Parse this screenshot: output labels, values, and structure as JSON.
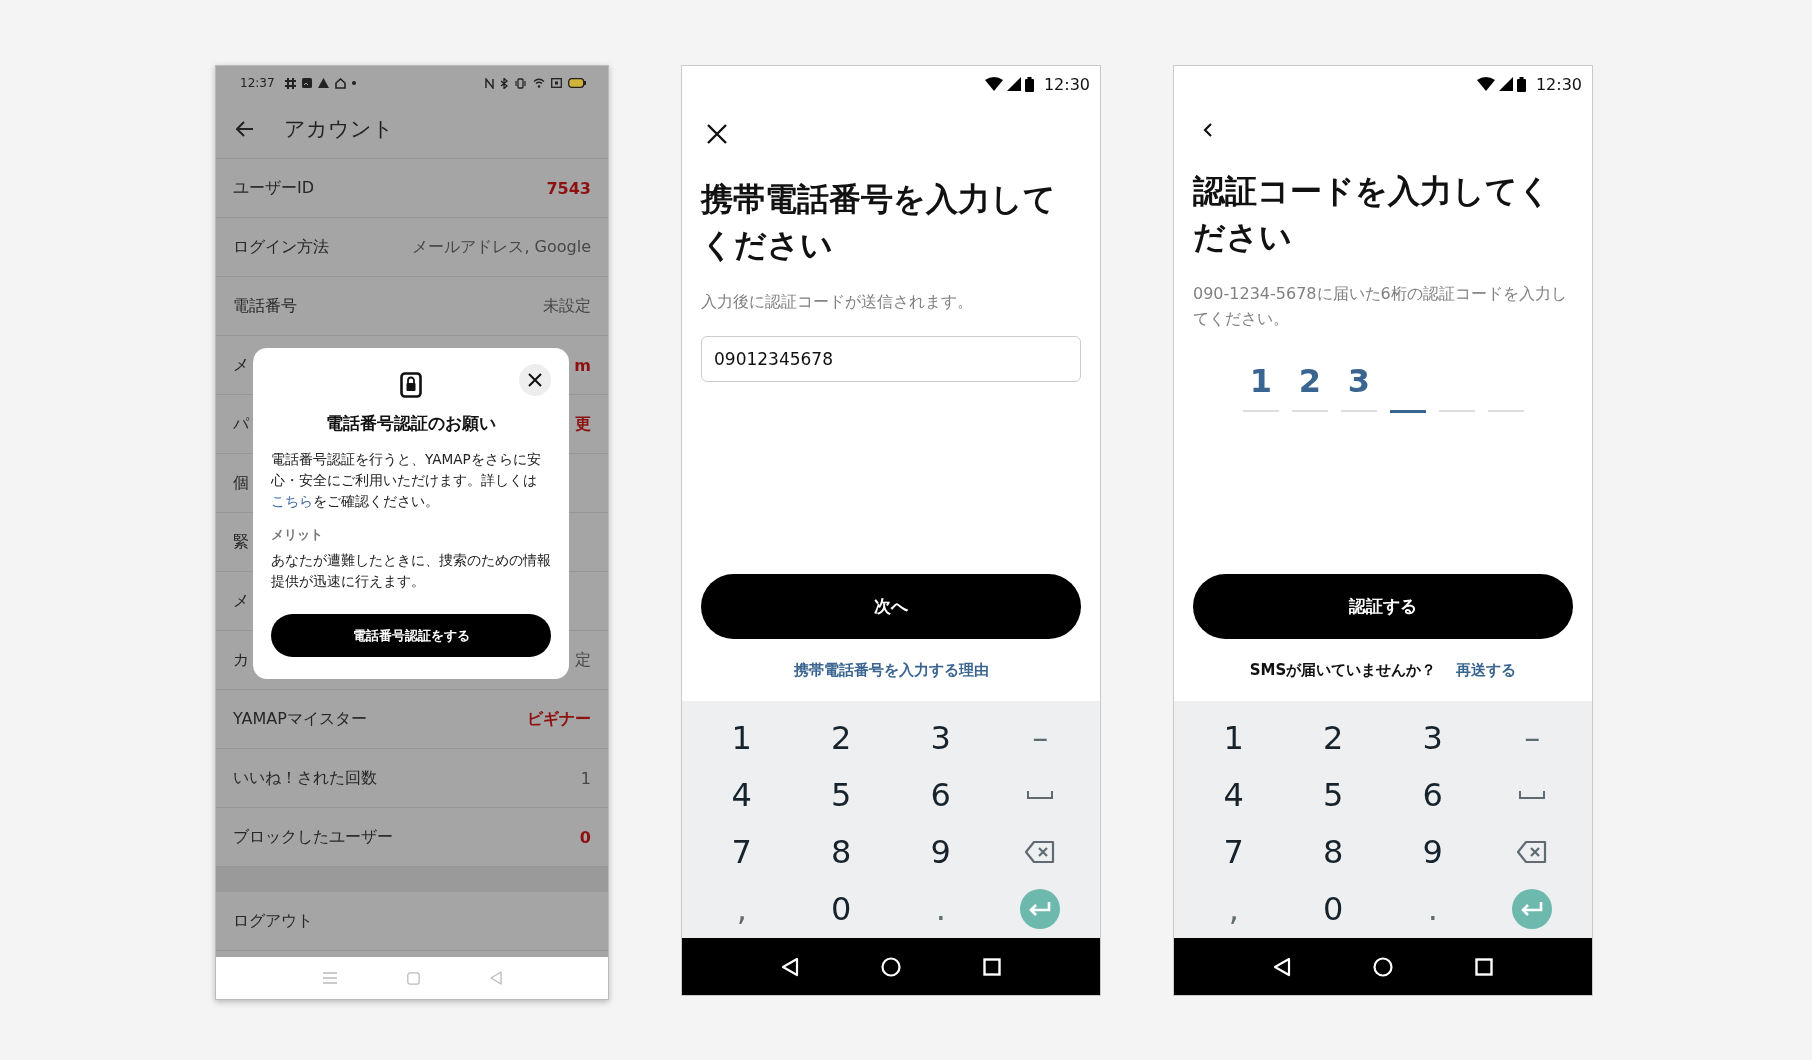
{
  "account_screen": {
    "status_bar": {
      "time": "12:37"
    },
    "header": {
      "title": "アカウント"
    },
    "rows": [
      {
        "label": "ユーザーID",
        "value": "7543",
        "kind": "alert"
      },
      {
        "label": "ログイン方法",
        "value": "メールアドレス, Google",
        "kind": "plain"
      },
      {
        "label": "電話番号",
        "value": "未設定",
        "kind": "plain"
      },
      {
        "label": "メ",
        "value": "m",
        "kind": "alert"
      },
      {
        "label": "パ",
        "value": "更",
        "kind": "alert"
      },
      {
        "label": "個"
      },
      {
        "label": "緊"
      },
      {
        "label": "メ"
      },
      {
        "label": "カ",
        "value": "定",
        "kind": "plain"
      },
      {
        "label": "YAMAPマイスター",
        "value": "ビギナー",
        "kind": "alert"
      },
      {
        "label": "いいね！された回数",
        "value": "1",
        "kind": "plain"
      },
      {
        "label": "ブロックしたユーザー",
        "value": "0",
        "kind": "alert"
      }
    ],
    "logout": "ログアウト",
    "dialog": {
      "title": "電話番号認証のお願い",
      "body": {
        "before": "電話番号認証を行うと、YAMAPをさらに安心・安全にご利用いただけます。詳しくは",
        "link": "こちら",
        "after": "をご確認ください。"
      },
      "section_label": "メリット",
      "merit": "あなたが遭難したときに、捜索のための情報提供が迅速に行えます。",
      "button": "電話番号認証をする"
    }
  },
  "phone_screen": {
    "status_bar": {
      "time": "12:30"
    },
    "title": "携帯電話番号を入力してください",
    "subtitle": "入力後に認証コードが送信されます。",
    "input": {
      "value": "09012345678"
    },
    "button": "次へ",
    "link": "携帯電話番号を入力する理由",
    "keypad": [
      {
        "kind": "char",
        "label": "1"
      },
      {
        "kind": "char",
        "label": "2"
      },
      {
        "kind": "char",
        "label": "3"
      },
      {
        "kind": "char",
        "label": "–"
      },
      {
        "kind": "char",
        "label": "4"
      },
      {
        "kind": "char",
        "label": "5"
      },
      {
        "kind": "char",
        "label": "6"
      },
      {
        "kind": "space"
      },
      {
        "kind": "char",
        "label": "7"
      },
      {
        "kind": "char",
        "label": "8"
      },
      {
        "kind": "char",
        "label": "9"
      },
      {
        "kind": "backspace"
      },
      {
        "kind": "char",
        "label": ","
      },
      {
        "kind": "char",
        "label": "0"
      },
      {
        "kind": "char",
        "label": "."
      },
      {
        "kind": "enter"
      }
    ]
  },
  "code_screen": {
    "status_bar": {
      "time": "12:30"
    },
    "title": "認証コードを入力してください",
    "description": "090-1234-5678に届いた6桁の認証コードを入力してください。",
    "code_slots": [
      {
        "digit": "1",
        "selected": false
      },
      {
        "digit": "2",
        "selected": false
      },
      {
        "digit": "3",
        "selected": false
      },
      {
        "selected": true
      },
      {
        "selected": false
      },
      {
        "selected": false
      }
    ],
    "button": "認証する",
    "prompt": "SMSが届いていませんか？",
    "link": "再送する",
    "keypad": [
      {
        "kind": "char",
        "label": "1"
      },
      {
        "kind": "char",
        "label": "2"
      },
      {
        "kind": "char",
        "label": "3"
      },
      {
        "kind": "char",
        "label": "–"
      },
      {
        "kind": "char",
        "label": "4"
      },
      {
        "kind": "char",
        "label": "5"
      },
      {
        "kind": "char",
        "label": "6"
      },
      {
        "kind": "space"
      },
      {
        "kind": "char",
        "label": "7"
      },
      {
        "kind": "char",
        "label": "8"
      },
      {
        "kind": "char",
        "label": "9"
      },
      {
        "kind": "backspace"
      },
      {
        "kind": "char",
        "label": ","
      },
      {
        "kind": "char",
        "label": "0"
      },
      {
        "kind": "char",
        "label": "."
      },
      {
        "kind": "enter"
      }
    ]
  }
}
